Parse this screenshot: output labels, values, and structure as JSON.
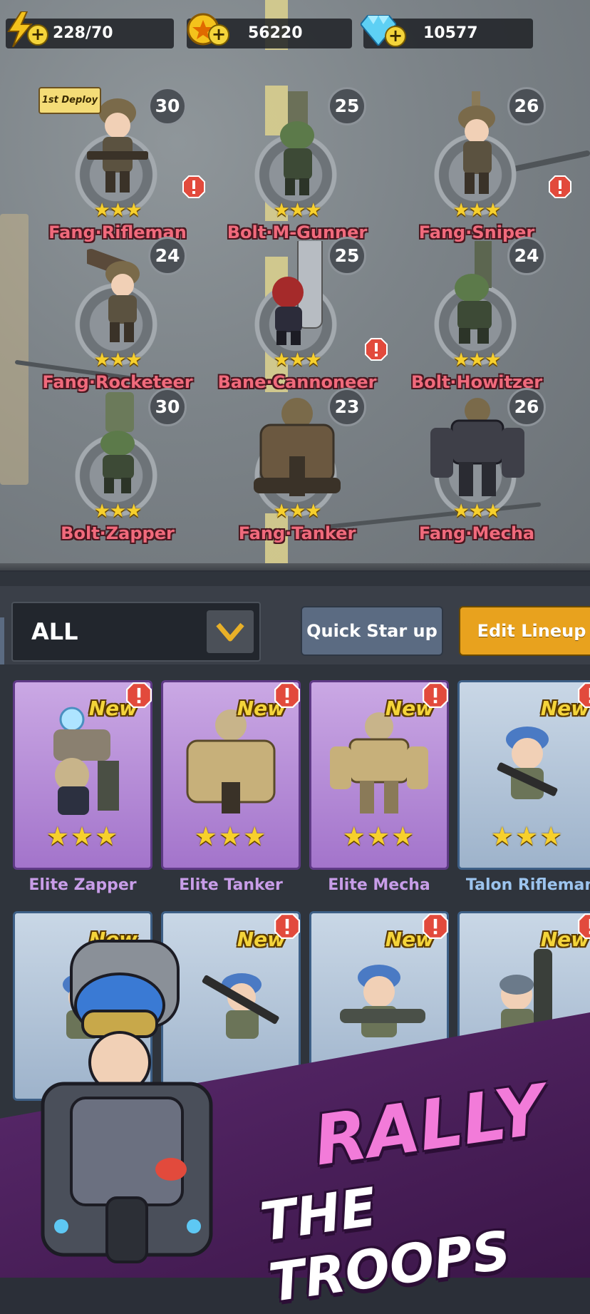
{
  "resources": {
    "energy": {
      "value": "228/70",
      "icon": "lightning-icon"
    },
    "gold": {
      "value": "56220",
      "icon": "gold-coin-icon"
    },
    "gems": {
      "value": "10577",
      "icon": "diamond-icon"
    }
  },
  "field": {
    "deploy_badge": "1st Deploy",
    "units": [
      {
        "name": "Fang·Rifleman",
        "level": "30",
        "stars": "★★★",
        "alert": true
      },
      {
        "name": "Bolt·M-Gunner",
        "level": "25",
        "stars": "★★★",
        "alert": false
      },
      {
        "name": "Fang·Sniper",
        "level": "26",
        "stars": "★★★",
        "alert": true
      },
      {
        "name": "Fang·Rocketeer",
        "level": "24",
        "stars": "★★★",
        "alert": false
      },
      {
        "name": "Bane·Cannoneer",
        "level": "25",
        "stars": "★★★",
        "alert": true
      },
      {
        "name": "Bolt·Howitzer",
        "level": "24",
        "stars": "★★★",
        "alert": false
      },
      {
        "name": "Bolt·Zapper",
        "level": "30",
        "stars": "★★★",
        "alert": false
      },
      {
        "name": "Fang·Tanker",
        "level": "23",
        "stars": "★★★",
        "alert": false
      },
      {
        "name": "Fang·Mecha",
        "level": "26",
        "stars": "★★★",
        "alert": false
      }
    ]
  },
  "toolbar": {
    "filter_label": "ALL",
    "quick_star_label": "Quick Star up",
    "edit_lineup_label": "Edit Lineup"
  },
  "cards": {
    "new_label": "New",
    "stars": "★★★",
    "row1": [
      {
        "name": "Elite Zapper",
        "tier": "purple"
      },
      {
        "name": "Elite Tanker",
        "tier": "purple"
      },
      {
        "name": "Elite Mecha",
        "tier": "purple"
      },
      {
        "name": "Talon Rifleman",
        "tier": "blue"
      }
    ]
  },
  "banner": {
    "line1": "RALLY",
    "line2": "THE TROOPS"
  },
  "colors": {
    "purple": "#a374cb",
    "blue": "#9eb3cb",
    "gold": "#e8a21e",
    "name_red": "#f06a7c"
  }
}
